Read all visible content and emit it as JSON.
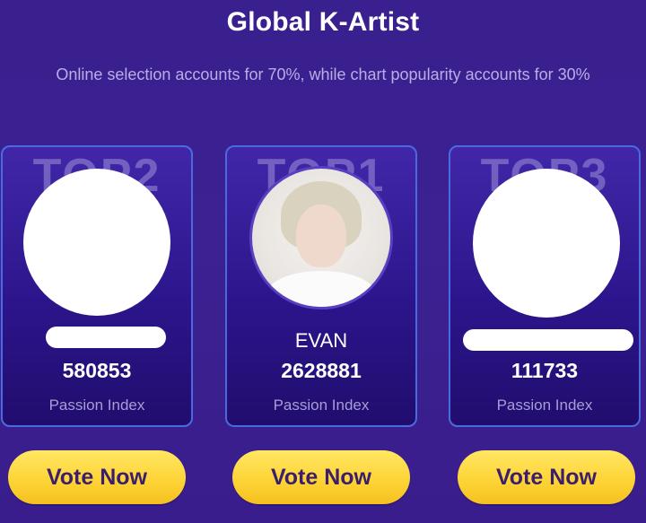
{
  "header": {
    "title": "Global K-Artist",
    "subtitle": "Online selection accounts for 70%, while chart popularity accounts for 30%"
  },
  "cards": [
    {
      "rank": "TOP2",
      "name": "",
      "score": "580853",
      "label": "Passion Index",
      "button": "Vote Now"
    },
    {
      "rank": "TOP1",
      "name": "EVAN",
      "score": "2628881",
      "label": "Passion Index",
      "button": "Vote Now"
    },
    {
      "rank": "TOP3",
      "name": "",
      "score": "111733",
      "label": "Passion Index",
      "button": "Vote Now"
    }
  ],
  "colors": {
    "background": "#3a1f8e",
    "card_border": "#4a6be0",
    "button": "#fdd334",
    "button_text": "#3c1e6a"
  }
}
